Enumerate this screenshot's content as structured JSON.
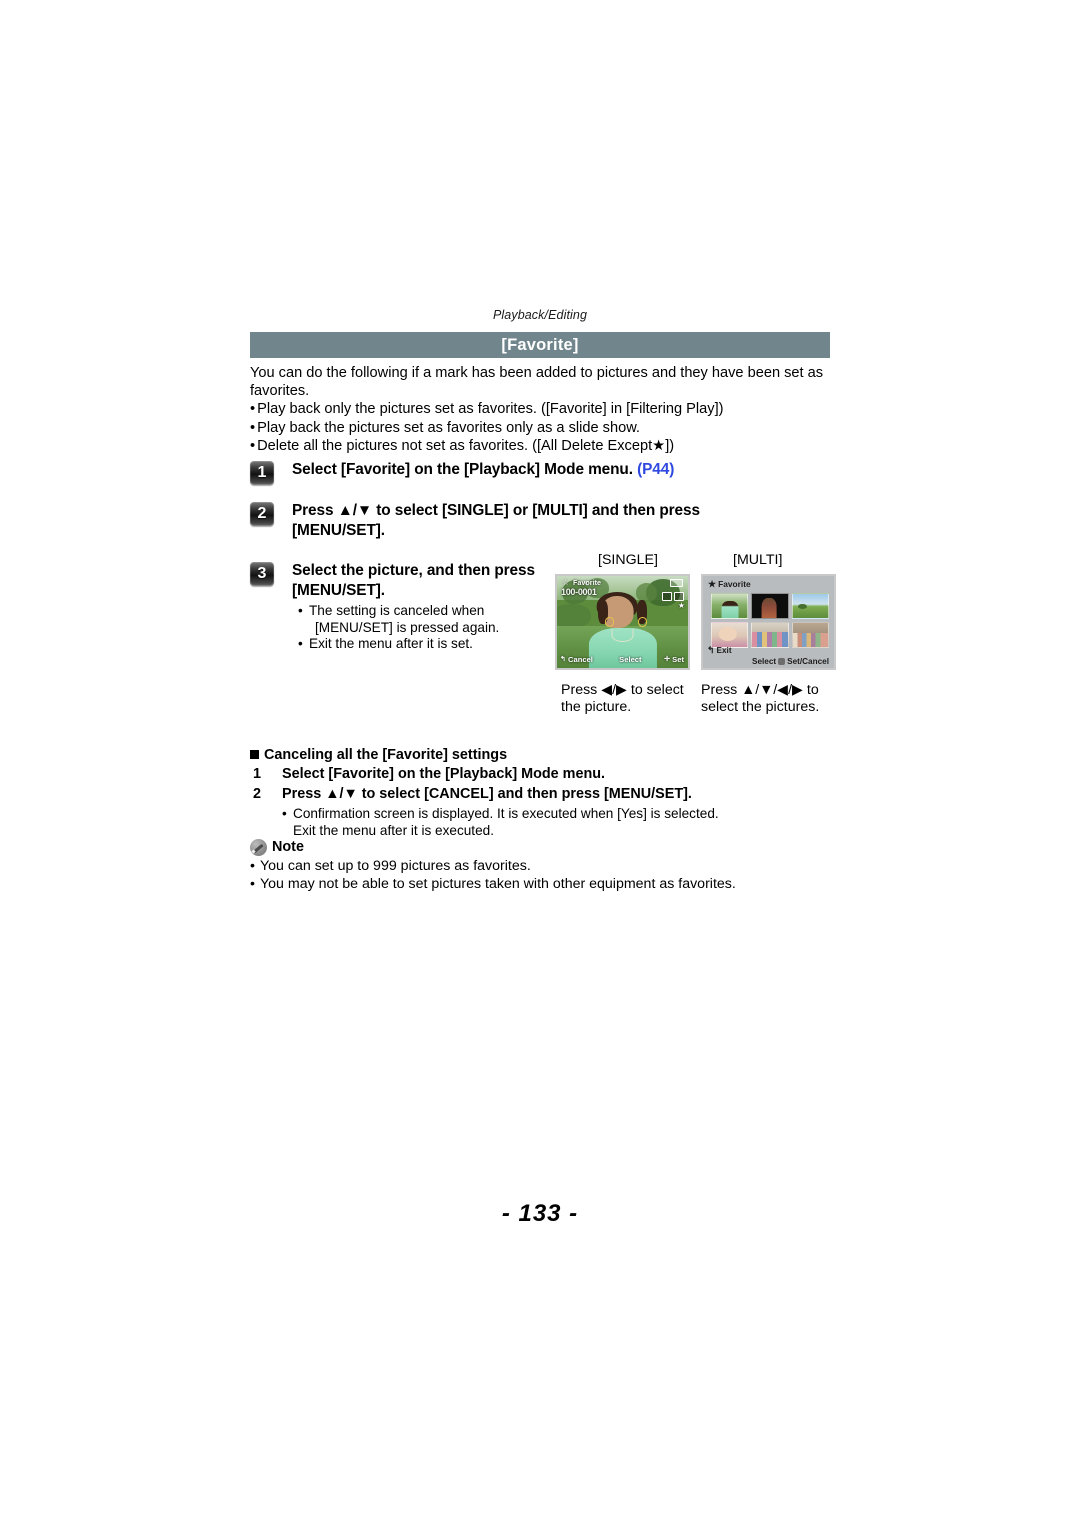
{
  "running_head": "Playback/Editing",
  "section_title": "[Favorite]",
  "intro": {
    "paragraph": "You can do the following if a mark has been added to pictures and they have been set as favorites.",
    "bullets": [
      "Play back only the pictures set as favorites. ([Favorite] in [Filtering Play])",
      "Play back the pictures set as favorites only as a slide show.",
      "Delete all the pictures not set as favorites. ([All Delete Except★])"
    ]
  },
  "steps": [
    {
      "number": "1",
      "text": "Select [Favorite] on the [Playback] Mode menu. ",
      "ref": "(P44)"
    },
    {
      "number": "2",
      "text": "Press ▲/▼ to select [SINGLE] or [MULTI] and then press [MENU/SET].",
      "ref": ""
    },
    {
      "number": "3",
      "text": "Select the picture, and then press [MENU/SET].",
      "ref": ""
    }
  ],
  "step3_bullets": [
    {
      "line1": "The setting is canceled when",
      "line2": "[MENU/SET] is pressed again."
    },
    {
      "line1": "Exit the menu after it is set.",
      "line2": ""
    }
  ],
  "figures": {
    "label_single": "[SINGLE]",
    "label_multi": "[MULTI]",
    "caption_single": "Press ◀/▶ to select the picture.",
    "caption_multi": "Press ▲/▼/◀/▶ to select the pictures.",
    "single_screen": {
      "favorite_label": "Favorite",
      "file_number": "100-0001",
      "star_icon": "star-icon",
      "battery_icon": "battery-icon",
      "cancel_label": "Cancel",
      "select_label": "Select",
      "set_label": "Set"
    },
    "multi_screen": {
      "header": "Favorite",
      "star_icon": "star-icon",
      "exit_label": "Exit",
      "select_label": "Select",
      "setcancel_label": "Set/Cancel",
      "thumbnails": [
        "woman-in-green-outdoors",
        "guitarist-on-black",
        "green-landscape",
        "baby-portrait",
        "group-of-girls",
        "family-group"
      ]
    }
  },
  "canceling": {
    "heading": "Canceling all the [Favorite] settings",
    "steps": [
      {
        "number": "1",
        "text": "Select [Favorite] on the [Playback] Mode menu."
      },
      {
        "number": "2",
        "text": "Press ▲/▼ to select [CANCEL] and then press [MENU/SET]."
      }
    ],
    "note_line1": "Confirmation screen is displayed. It is executed when [Yes] is selected.",
    "note_line2": "Exit the menu after it is executed."
  },
  "note": {
    "title": "Note",
    "icon": "pencil-icon",
    "items": [
      "You can set up to 999 pictures as favorites.",
      "You may not be able to set pictures taken with other equipment as favorites."
    ]
  },
  "page_number": "- 133 -",
  "colors": {
    "title_bar": "#70868c",
    "ref_link": "#2f49e0"
  }
}
